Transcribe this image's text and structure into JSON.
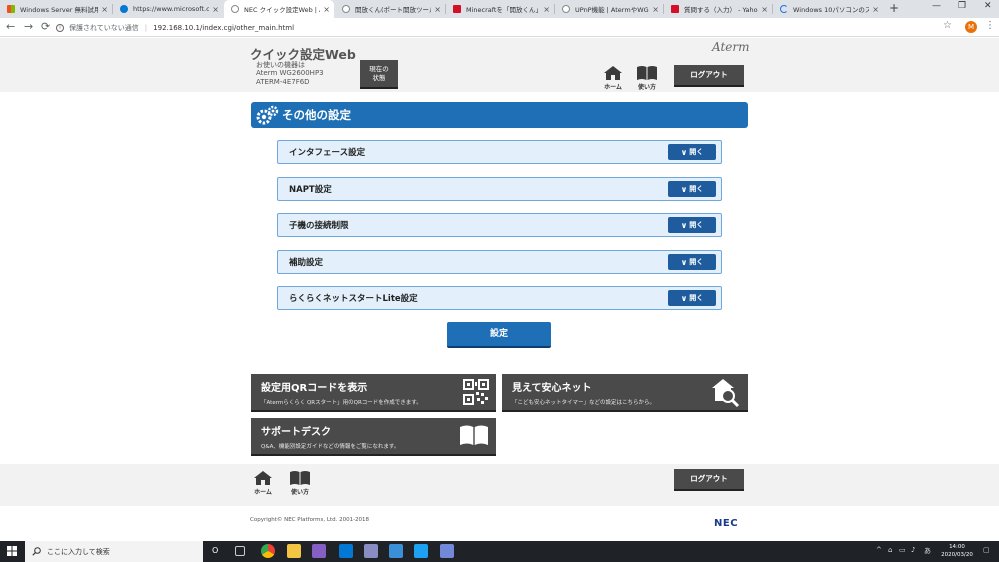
{
  "browser": {
    "tabs": [
      {
        "label": "Windows Server 無料試用版",
        "favicon_color": "#f25022",
        "active": false
      },
      {
        "label": "https://www.microsoft.com/",
        "favicon_color": "#0078d4",
        "active": false
      },
      {
        "label": "NEC クイック設定Web | Aterm",
        "favicon_color": "#5f6368",
        "active": true
      },
      {
        "label": "開放くん(ポート開放ツール)",
        "favicon_color": "#5f6368",
        "active": false
      },
      {
        "label": "Minecraftを「開放くん」を使用",
        "favicon_color": "#d50f25",
        "active": false
      },
      {
        "label": "UPnP機能 | AtermやWG26",
        "favicon_color": "#5f6368",
        "active": false
      },
      {
        "label": "質問する（入力） - Yahoo!知",
        "favicon_color": "#d50f25",
        "active": false
      },
      {
        "label": "Windows 10パソコンのスクリー",
        "favicon_color": "#1a73e8",
        "active": false
      }
    ],
    "close_glyph": "×",
    "new_tab": "+",
    "window_controls": [
      "—",
      "❐",
      "✕"
    ],
    "security_text": "保護されていない通信",
    "url": "192.168.10.1/index.cgi/other_main.html",
    "profile_initial": "M"
  },
  "header": {
    "title": "クイック設定Web",
    "device_label": "お使いの機器は",
    "device_model": "Aterm WG2600HP3",
    "device_name": "ATERM-4E7F6D",
    "status_button": [
      "現在の",
      "状態"
    ],
    "brand": "Aterm",
    "home_label": "ホーム",
    "manual_label": "使い方",
    "logout_label": "ログアウト"
  },
  "main": {
    "section_title": "その他の設定",
    "open_label": "開く",
    "items": [
      {
        "label": "インタフェース設定"
      },
      {
        "label": "NAPT設定"
      },
      {
        "label": "子機の接続制限"
      },
      {
        "label": "補助設定"
      },
      {
        "label": "らくらくネットスタートLite設定"
      }
    ],
    "apply_label": "設定"
  },
  "cards": [
    {
      "title": "設定用QRコードを表示",
      "desc": "「Atermらくらく QRスタート」用のQRコードを作成できます。",
      "icon": "qr-code-icon"
    },
    {
      "title": "見えて安心ネット",
      "desc": "「こども安心ネットタイマー」などの設定はこちらから。",
      "icon": "house-search-icon"
    },
    {
      "title": "サポートデスク",
      "desc": "Q&A、機能別設定ガイドなどの情報をご覧になれます。",
      "icon": "book-icon"
    }
  ],
  "footer": {
    "home_label": "ホーム",
    "manual_label": "使い方",
    "logout_label": "ログアウト",
    "copyright": "Copyright© NEC Platforms, Ltd. 2001-2018",
    "logo": "NEC"
  },
  "taskbar": {
    "search_placeholder": "ここに入力して検索",
    "cortana": "O",
    "tray_chevron": "^",
    "ime": "あ",
    "time": "14:00",
    "date": "2020/03/20"
  },
  "colors": {
    "accent_blue": "#1e6fb5",
    "dark_button": "#4a4a4a",
    "row_bg": "#e3f0fb"
  }
}
